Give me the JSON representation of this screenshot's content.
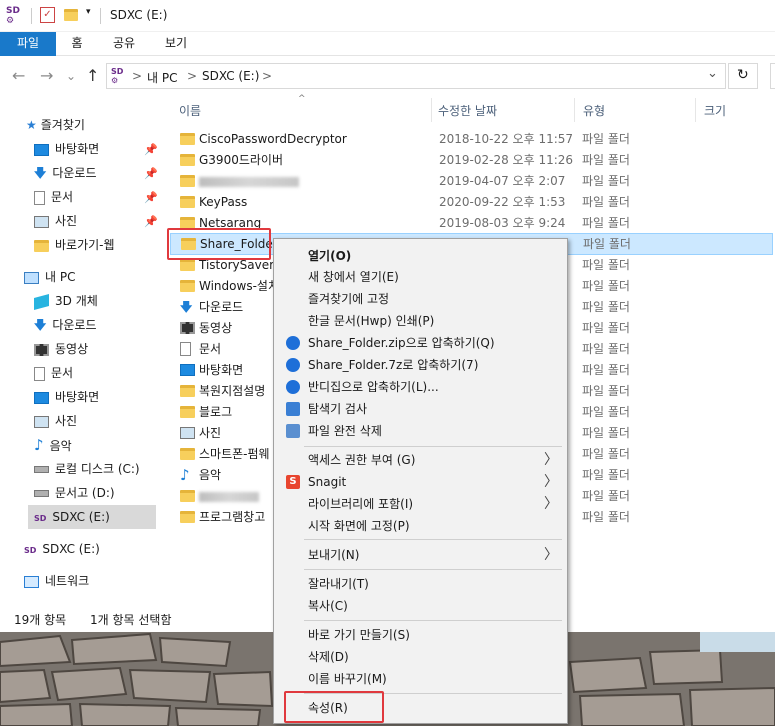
{
  "window": {
    "title": "SDXC (E:)",
    "app_icon": "sd-card-icon"
  },
  "ribbon": {
    "tabs": [
      "파일",
      "홈",
      "공유",
      "보기"
    ],
    "active_tab": "파일",
    "accent": "#1979ca"
  },
  "address": {
    "crumbs": [
      "내 PC",
      "SDXC (E:)"
    ],
    "sep": ">",
    "chevron": "⌄",
    "refresh": "↻"
  },
  "nav": {
    "back": "←",
    "forward": "→",
    "recent": "⌄",
    "up": "↑"
  },
  "sidebar": {
    "quick_access": "즐겨찾기",
    "quick_items": [
      {
        "label": "바탕화면",
        "icon": "desktop-icon",
        "pinned": true
      },
      {
        "label": "다운로드",
        "icon": "download-icon",
        "pinned": true
      },
      {
        "label": "문서",
        "icon": "document-icon",
        "pinned": true
      },
      {
        "label": "사진",
        "icon": "picture-icon",
        "pinned": true
      },
      {
        "label": "바로가기-웹",
        "icon": "folder-icon",
        "pinned": false
      }
    ],
    "this_pc": "내 PC",
    "pc_items": [
      {
        "label": "3D 개체",
        "icon": "3d-objects-icon"
      },
      {
        "label": "다운로드",
        "icon": "download-icon"
      },
      {
        "label": "동영상",
        "icon": "video-icon"
      },
      {
        "label": "문서",
        "icon": "document-icon"
      },
      {
        "label": "바탕화면",
        "icon": "desktop-icon"
      },
      {
        "label": "사진",
        "icon": "picture-icon"
      },
      {
        "label": "음악",
        "icon": "music-icon"
      },
      {
        "label": "로컬 디스크 (C:)",
        "icon": "disk-icon"
      },
      {
        "label": "문서고 (D:)",
        "icon": "disk-icon"
      },
      {
        "label": "SDXC (E:)",
        "icon": "sd-card-icon",
        "selected": true
      }
    ],
    "drive": "SDXC (E:)",
    "network": "네트워크"
  },
  "columns": {
    "name": "이름",
    "modified": "수정한 날짜",
    "type": "유형",
    "size": "크기"
  },
  "files": [
    {
      "name": "CiscoPasswordDecryptor",
      "date": "2018-10-22 오후 11:57",
      "type": "파일 폴더",
      "icon": "folder"
    },
    {
      "name": "G3900드라이버",
      "date": "2019-02-28 오후 11:26",
      "type": "파일 폴더",
      "icon": "folder"
    },
    {
      "name": "",
      "date": "2019-04-07 오후 2:07",
      "type": "파일 폴더",
      "icon": "folder",
      "blurred": true
    },
    {
      "name": "KeyPass",
      "date": "2020-09-22 오후 1:53",
      "type": "파일 폴더",
      "icon": "folder"
    },
    {
      "name": "Netsarang",
      "date": "2019-08-03 오후 9:24",
      "type": "파일 폴더",
      "icon": "folder"
    },
    {
      "name": "Share_Folder",
      "date": "",
      "type": "파일 폴더",
      "icon": "folder",
      "selected": true
    },
    {
      "name": "TistorySaver",
      "date": "",
      "type": "파일 폴더",
      "icon": "folder"
    },
    {
      "name": "Windows-설치",
      "date": "",
      "type": "파일 폴더",
      "icon": "folder"
    },
    {
      "name": "다운로드",
      "date": "",
      "type": "파일 폴더",
      "icon": "download"
    },
    {
      "name": "동영상",
      "date": "",
      "type": "파일 폴더",
      "icon": "video"
    },
    {
      "name": "문서",
      "date": "",
      "type": "파일 폴더",
      "icon": "document"
    },
    {
      "name": "바탕화면",
      "date": "",
      "type": "파일 폴더",
      "icon": "desktop"
    },
    {
      "name": "복원지점설명",
      "date": "",
      "type": "파일 폴더",
      "icon": "folder"
    },
    {
      "name": "블로그",
      "date": "",
      "type": "파일 폴더",
      "icon": "folder"
    },
    {
      "name": "사진",
      "date": "",
      "type": "파일 폴더",
      "icon": "picture"
    },
    {
      "name": "스마트폰-펌웨",
      "date": "",
      "type": "파일 폴더",
      "icon": "folder"
    },
    {
      "name": "음악",
      "date": "",
      "type": "파일 폴더",
      "icon": "music"
    },
    {
      "name": "",
      "date": "",
      "type": "파일 폴더",
      "icon": "folder",
      "blurred": true
    },
    {
      "name": "프로그램창고",
      "date": "",
      "type": "파일 폴더",
      "icon": "folder"
    }
  ],
  "status": {
    "count": "19개 항목",
    "selected": "1개 항목 선택함"
  },
  "context_menu": {
    "items": [
      {
        "label": "열기(O)",
        "bold": true
      },
      {
        "label": "새 창에서 열기(E)"
      },
      {
        "label": "즐겨찾기에 고정"
      },
      {
        "label": "한글 문서(Hwp) 인쇄(P)"
      },
      {
        "label": "Share_Folder.zip으로 압축하기(Q)",
        "icon": "bandizip-icon"
      },
      {
        "label": "Share_Folder.7z로 압축하기(7)",
        "icon": "bandizip-icon"
      },
      {
        "label": "반디집으로 압축하기(L)...",
        "icon": "bandizip-icon"
      },
      {
        "label": "탐색기 검사",
        "icon": "scan-icon"
      },
      {
        "label": "파일 완전 삭제",
        "icon": "shred-icon"
      },
      {
        "label": "액세스 권한 부여 (G)",
        "submenu": true
      },
      {
        "label": "Snagit",
        "icon": "snagit-icon",
        "submenu": true
      },
      {
        "label": "라이브러리에 포함(I)",
        "submenu": true
      },
      {
        "label": "시작 화면에 고정(P)"
      },
      {
        "label": "보내기(N)",
        "submenu": true
      },
      {
        "label": "잘라내기(T)"
      },
      {
        "label": "복사(C)"
      },
      {
        "label": "바로 가기 만들기(S)"
      },
      {
        "label": "삭제(D)"
      },
      {
        "label": "이름 바꾸기(M)"
      },
      {
        "label": "속성(R)",
        "highlighted": true
      }
    ],
    "submenu_arrow": "〉"
  },
  "colors": {
    "highlight": "#e0393e",
    "selection": "#cce8ff",
    "folder": "#f7cf5c"
  }
}
